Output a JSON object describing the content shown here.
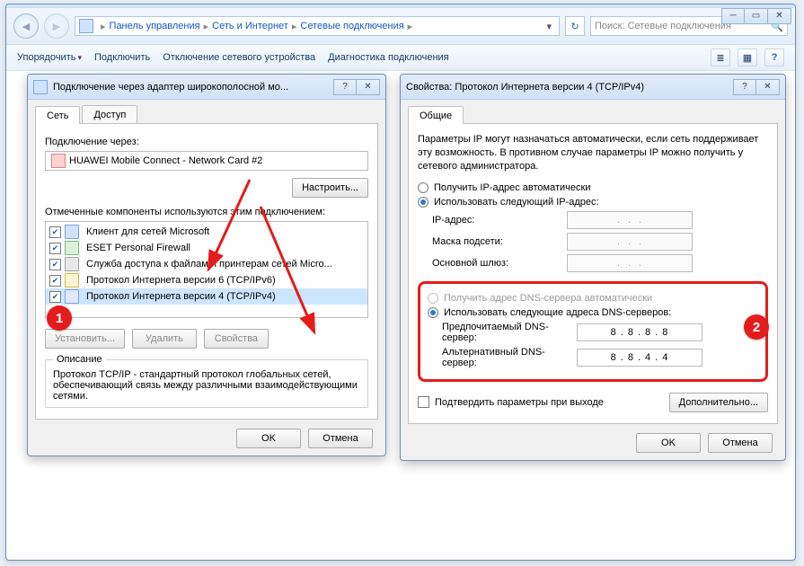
{
  "explorer": {
    "breadcrumbs": [
      "Панель управления",
      "Сеть и Интернет",
      "Сетевые подключения"
    ],
    "search_placeholder": "Поиск: Сетевые подключения",
    "commands": {
      "organize": "Упорядочить",
      "connect": "Подключить",
      "disable": "Отключение сетевого устройства",
      "diagnose": "Диагностика подключения"
    }
  },
  "left": {
    "title": "Подключение через адаптер широкополосной мо...",
    "tabs": {
      "net": "Сеть",
      "access": "Доступ"
    },
    "connect_through_label": "Подключение через:",
    "adapter": "HUAWEI Mobile Connect - Network Card #2",
    "configure_btn": "Настроить...",
    "items_label": "Отмеченные компоненты используются этим подключением:",
    "items": [
      {
        "label": "Клиент для сетей Microsoft",
        "checked": true,
        "icon": "ic-net"
      },
      {
        "label": "ESET Personal Firewall",
        "checked": true,
        "icon": "ic-shield"
      },
      {
        "label": "Служба доступа к файлам и принтерам сетей Micro...",
        "checked": true,
        "icon": "ic-print"
      },
      {
        "label": "Протокол Интернета версии 6 (TCP/IPv6)",
        "checked": true,
        "icon": "ic-v6"
      },
      {
        "label": "Протокол Интернета версии 4 (TCP/IPv4)",
        "checked": true,
        "icon": "ic-v4",
        "selected": true
      }
    ],
    "install_btn": "Установить...",
    "uninstall_btn": "Удалить",
    "props_btn": "Свойства",
    "desc_title": "Описание",
    "desc_text": "Протокол TCP/IP - стандартный протокол глобальных сетей, обеспечивающий связь между различными взаимодействующими сетями.",
    "ok": "OK",
    "cancel": "Отмена"
  },
  "right": {
    "title": "Свойства: Протокол Интернета версии 4 (TCP/IPv4)",
    "tab_general": "Общие",
    "info": "Параметры IP могут назначаться автоматически, если сеть поддерживает эту возможность. В противном случае параметры IP можно получить у сетевого администратора.",
    "ip_auto": "Получить IP-адрес автоматически",
    "ip_manual": "Использовать следующий IP-адрес:",
    "ip_label": "IP-адрес:",
    "mask_label": "Маска подсети:",
    "gw_label": "Основной шлюз:",
    "dns_auto": "Получить адрес DNS-сервера автоматически",
    "dns_manual": "Использовать следующие адреса DNS-серверов:",
    "pref_dns_label": "Предпочитаемый DNS-сервер:",
    "alt_dns_label": "Альтернативный DNS-сервер:",
    "pref_dns": [
      "8",
      "8",
      "8",
      "8"
    ],
    "alt_dns": [
      "8",
      "8",
      "4",
      "4"
    ],
    "confirm": "Подтвердить параметры при выходе",
    "advanced": "Дополнительно...",
    "ok": "OK",
    "cancel": "Отмена"
  },
  "annotations": {
    "b1": "1",
    "b2": "2"
  }
}
